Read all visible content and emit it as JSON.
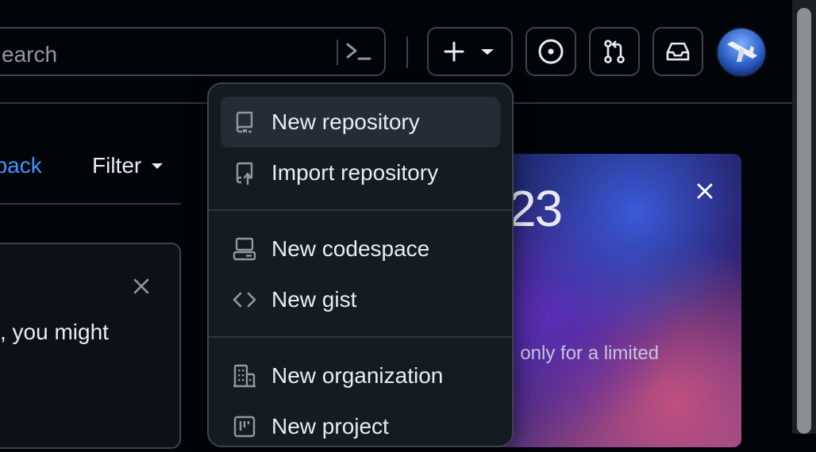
{
  "header": {
    "search_placeholder": "Search",
    "search_visible_text": "earch",
    "create_button": "create-new",
    "issues_icon": "issue-opened-icon",
    "pulls_icon": "git-pull-request-icon",
    "inbox_icon": "inbox-icon"
  },
  "feed": {
    "feedback_link": "dback",
    "filter_label": "Filter",
    "card_text": ", you might"
  },
  "promo": {
    "year": "23",
    "text": ", only for a limited"
  },
  "menu": {
    "items": [
      {
        "label": "New repository",
        "icon": "repo-icon"
      },
      {
        "label": "Import repository",
        "icon": "repo-push-icon"
      },
      {
        "label": "New codespace",
        "icon": "codespaces-icon"
      },
      {
        "label": "New gist",
        "icon": "code-icon"
      },
      {
        "label": "New organization",
        "icon": "organization-icon"
      },
      {
        "label": "New project",
        "icon": "project-icon"
      }
    ]
  },
  "colors": {
    "background": "#010409",
    "menu_bg": "#151b23",
    "border": "#3d444d",
    "link": "#4493f8",
    "text": "#e6edf3"
  }
}
